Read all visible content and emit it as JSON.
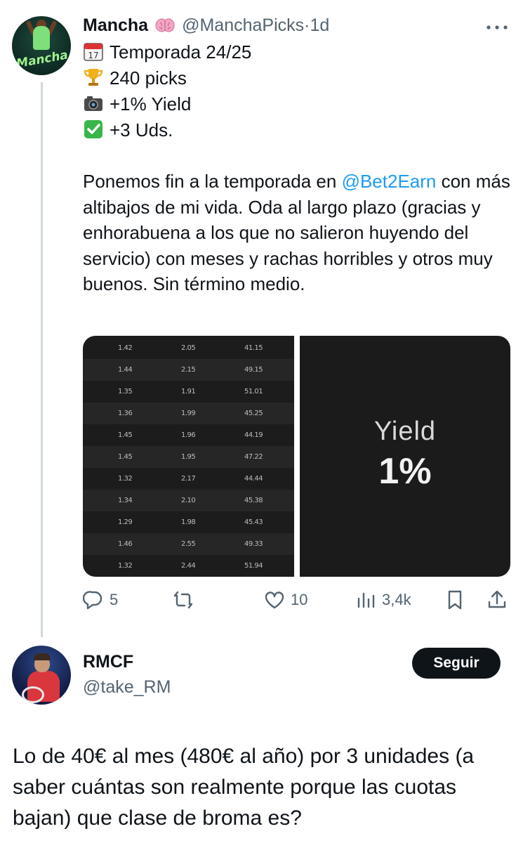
{
  "tweet": {
    "author_name": "Mancha",
    "author_emoji_icon": "brain-icon",
    "handle": "@ManchaPicks",
    "separator": "·",
    "time": "1d",
    "avatar_text": "Mancha",
    "stats": [
      {
        "icon": "calendar-icon",
        "text": "Temporada 24/25"
      },
      {
        "icon": "trophy-icon",
        "text": "240 picks"
      },
      {
        "icon": "camera-icon",
        "text": "+1% Yield"
      },
      {
        "icon": "check-icon",
        "text": "+3 Uds."
      }
    ],
    "body_before": "Ponemos fin a la temporada en ",
    "mention": "@Bet2Earn",
    "body_after": "  con más altibajos de mi vida. Oda al largo plazo (gracias y enhorabuena a los que no salieron huyendo del servicio) con meses y rachas horribles y otros muy buenos. Sin término medio.",
    "media": {
      "table_rows": [
        [
          "1.42",
          "2.05",
          "41.15"
        ],
        [
          "1.44",
          "2.15",
          "49.15"
        ],
        [
          "1.35",
          "1.91",
          "51.01"
        ],
        [
          "1.36",
          "1.99",
          "45.25"
        ],
        [
          "1.45",
          "1.96",
          "44.19"
        ],
        [
          "1.45",
          "1.95",
          "47.22"
        ],
        [
          "1.32",
          "2.17",
          "44.44"
        ],
        [
          "1.34",
          "2.10",
          "45.38"
        ],
        [
          "1.29",
          "1.98",
          "45.43"
        ],
        [
          "1.46",
          "2.55",
          "49.33"
        ],
        [
          "1.32",
          "2.44",
          "51.94"
        ]
      ],
      "yield_label": "Yield",
      "yield_value": "1%"
    },
    "actions": {
      "replies": "5",
      "retweets": "",
      "likes": "10",
      "views": "3,4k"
    }
  },
  "reply": {
    "author_name": "RMCF",
    "handle": "@take_RM",
    "follow_label": "Seguir",
    "body": "Lo de 40€ al mes (480€ al año) por 3 unidades (a saber cuántas son realmente porque las cuotas bajan) que clase de broma es?"
  },
  "colors": {
    "text": "#0f1419",
    "secondary": "#536471",
    "link": "#1d9bf0",
    "thread_line": "#cfd9de"
  }
}
